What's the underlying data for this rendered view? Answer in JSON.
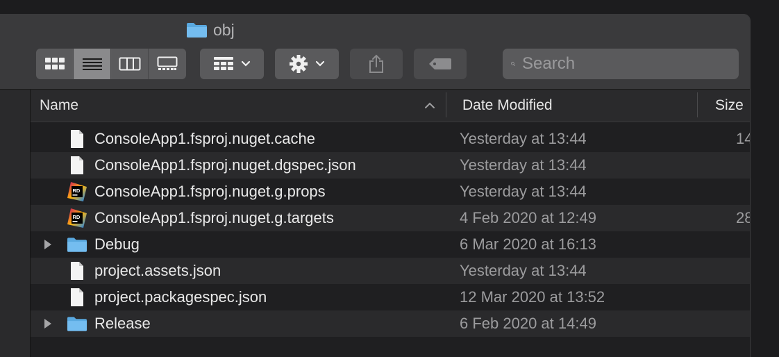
{
  "window": {
    "title": "obj"
  },
  "toolbar": {
    "view_modes": [
      "icon-view",
      "list-view",
      "column-view",
      "gallery-view"
    ],
    "active_view": "list-view",
    "group_icon": "group-by-icon",
    "action_icon": "gear-icon",
    "share_icon": "share-icon",
    "tag_icon": "tag-icon"
  },
  "search": {
    "placeholder": "Search",
    "value": ""
  },
  "columns": {
    "name": "Name",
    "date": "Date Modified",
    "size": "Size"
  },
  "files": [
    {
      "name": "ConsoleApp1.fsproj.nuget.cache",
      "date": "Yesterday at 13:44",
      "size": "14",
      "type": "document",
      "expandable": false
    },
    {
      "name": "ConsoleApp1.fsproj.nuget.dgspec.json",
      "date": "Yesterday at 13:44",
      "size": "",
      "type": "document",
      "expandable": false
    },
    {
      "name": "ConsoleApp1.fsproj.nuget.g.props",
      "date": "Yesterday at 13:44",
      "size": "",
      "type": "rider",
      "expandable": false
    },
    {
      "name": "ConsoleApp1.fsproj.nuget.g.targets",
      "date": "4 Feb 2020 at 12:49",
      "size": "28",
      "type": "rider",
      "expandable": false
    },
    {
      "name": "Debug",
      "date": "6 Mar 2020 at 16:13",
      "size": "",
      "type": "folder",
      "expandable": true
    },
    {
      "name": "project.assets.json",
      "date": "Yesterday at 13:44",
      "size": "",
      "type": "document",
      "expandable": false
    },
    {
      "name": "project.packagespec.json",
      "date": "12 Mar 2020 at 13:52",
      "size": "",
      "type": "document",
      "expandable": false
    },
    {
      "name": "Release",
      "date": "6 Feb 2020 at 14:49",
      "size": "",
      "type": "folder",
      "expandable": true
    }
  ],
  "colors": {
    "folder": "#6bb6e8",
    "accent": "#8a8a8c",
    "rider": "#d7286a"
  }
}
